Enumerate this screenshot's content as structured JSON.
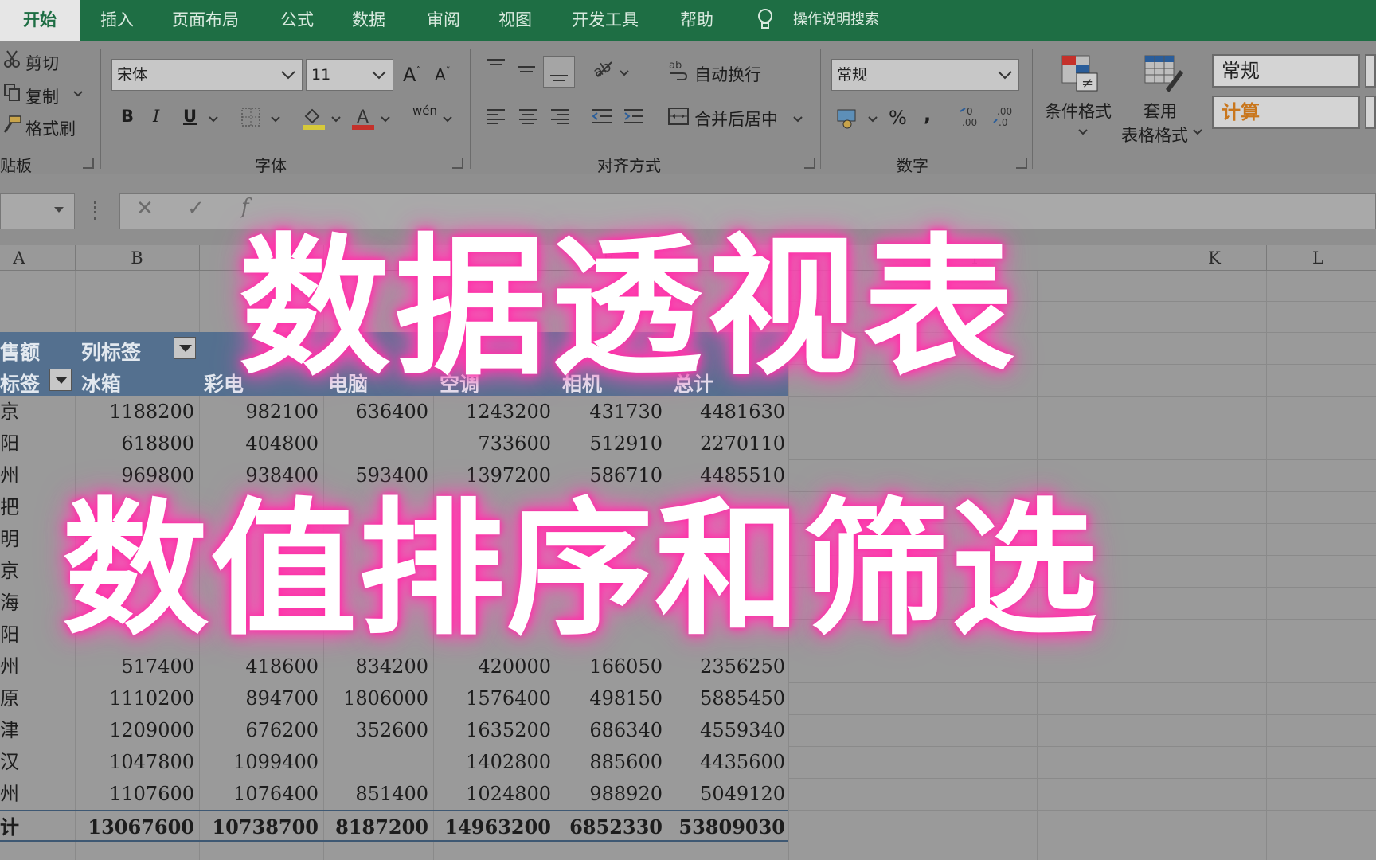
{
  "tabs": [
    "开始",
    "插入",
    "页面布局",
    "公式",
    "数据",
    "审阅",
    "视图",
    "开发工具",
    "帮助"
  ],
  "tell_me": "操作说明搜索",
  "clipboard": {
    "cut": "剪切",
    "copy": "复制",
    "format_painter": "格式刷",
    "group": "贴板"
  },
  "font": {
    "name": "宋体",
    "size": "11",
    "group": "字体",
    "bold": "B",
    "italic": "I",
    "underline": "U",
    "phonetic": "wén"
  },
  "alignment": {
    "wrap_text": "自动换行",
    "merge_center": "合并后居中",
    "group": "对齐方式"
  },
  "number": {
    "format": "常规",
    "percent": "%",
    "comma": ",",
    "group": "数字"
  },
  "styles": {
    "conditional": "条件格式",
    "table_format_1": "套用",
    "table_format_2": "表格格式",
    "normal": "常规",
    "calc": "计算"
  },
  "columns": [
    "A",
    "B",
    "F",
    "I",
    "K",
    "L"
  ],
  "pivot": {
    "value_label": "售额",
    "col_label": "列标签",
    "row_label": "标签",
    "headers": [
      "冰箱",
      "彩电",
      "电脑",
      "空调",
      "相机",
      "总计"
    ],
    "rows": [
      {
        "label": "京",
        "values": [
          "1188200",
          "982100",
          "636400",
          "1243200",
          "431730",
          "4481630"
        ]
      },
      {
        "label": "阳",
        "values": [
          "618800",
          "404800",
          "",
          "733600",
          "512910",
          "2270110"
        ]
      },
      {
        "label": "州",
        "values": [
          "969800",
          "938400",
          "593400",
          "1397200",
          "586710",
          "4485510"
        ]
      },
      {
        "label": "把",
        "values": [
          "",
          "",
          "",
          "",
          "",
          ""
        ]
      },
      {
        "label": "明",
        "values": [
          "",
          "",
          "",
          "",
          "",
          ""
        ]
      },
      {
        "label": "京",
        "values": [
          "",
          "",
          "",
          "",
          "",
          ""
        ]
      },
      {
        "label": "海",
        "values": [
          "",
          "",
          "",
          "",
          "",
          ""
        ]
      },
      {
        "label": "阳",
        "values": [
          "",
          "",
          "",
          "",
          "",
          ""
        ]
      },
      {
        "label": "州",
        "values": [
          "517400",
          "418600",
          "834200",
          "420000",
          "166050",
          "2356250"
        ]
      },
      {
        "label": "原",
        "values": [
          "1110200",
          "894700",
          "1806000",
          "1576400",
          "498150",
          "5885450"
        ]
      },
      {
        "label": "津",
        "values": [
          "1209000",
          "676200",
          "352600",
          "1635200",
          "686340",
          "4559340"
        ]
      },
      {
        "label": "汉",
        "values": [
          "1047800",
          "1099400",
          "",
          "1402800",
          "885600",
          "4435600"
        ]
      },
      {
        "label": "州",
        "values": [
          "1107600",
          "1076400",
          "851400",
          "1024800",
          "988920",
          "5049120"
        ]
      }
    ],
    "total": {
      "label": "计",
      "values": [
        "13067600",
        "10738700",
        "8187200",
        "14963200",
        "6852330",
        "53809030"
      ]
    }
  },
  "overlay": {
    "line1": "数据透视表",
    "line2": "数值排序和筛选"
  }
}
